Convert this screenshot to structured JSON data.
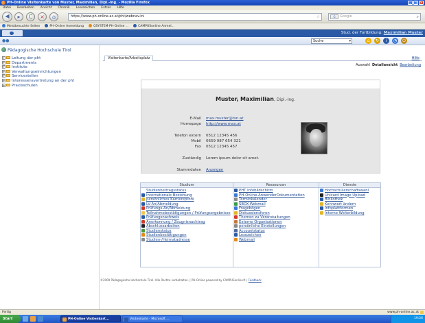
{
  "window": {
    "title": "PH-Online Visitenkarte von Muster, Maximilian, Dipl.-Ing. - Mozilla Firefox"
  },
  "menu": [
    "Datei",
    "Bearbeiten",
    "Ansicht",
    "Chronik",
    "Lesezeichen",
    "Extras",
    "Hilfe"
  ],
  "nav": {
    "url": "https://www.ph-online.ac.at/pht/webnav.ini",
    "search_placeholder": "Google"
  },
  "bookmarks": [
    {
      "label": "Meistbesuchte Seiten",
      "color": "#3a78d4"
    },
    {
      "label": "PH-Online Anmeldung",
      "color": "#2a5aa6"
    },
    {
      "label": "QSYSTEM-PH-Online ...",
      "color": "#e08a1a"
    },
    {
      "label": "CAMPUSonline Anmel...",
      "color": "#2a5aa6"
    }
  ],
  "portal": {
    "user_prefix": "Stud. der Fortbildung:",
    "user_name": "Maximilian Muster",
    "search_select": "Suche"
  },
  "sidebar": {
    "title": "Pädagogische Hochschule Tirol",
    "items": [
      "Leitung der pht",
      "Departments",
      "Institute",
      "Verwaltungseinrichtungen",
      "Servicestellen",
      "Interessensvertretung an der pht",
      "Praxisschulen"
    ]
  },
  "main": {
    "tab": "Visitenkarte/Arbeitsplatz",
    "help": "Hilfe",
    "view_links": {
      "auswahl": "Auswahl",
      "detailansicht": "Detailansicht",
      "bearbeiten": "Bearbeitung"
    },
    "person": {
      "last_name": "Muster,",
      "first_name": "Maximilian",
      "title": ", Dipl.-Ing."
    },
    "contact": {
      "email_label": "E-Mail",
      "email": "max.muster@tsn.at",
      "homepage_label": "Homepage",
      "homepage": "http://www.max.at",
      "phone_label": "Telefon extern",
      "phone": "0512 12345 456",
      "mobile_label": "Mobil",
      "mobile": "0659 987 654 321",
      "fax_label": "Fax",
      "fax": "0512 12345 457",
      "zust_label": "Zuständig",
      "zust": "Lorem ipsum dolor sit amet.",
      "stamm_label": "Stammdaten",
      "stamm": "Anzeigen"
    }
  },
  "services": {
    "studium": {
      "head": "Studium",
      "items": [
        {
          "label": "Studienbeitragsstatus",
          "color": "#ffffff"
        },
        {
          "label": "Internationale Beziehung",
          "color": "#2a5aa6"
        },
        {
          "label": "persönliches Karriereprofil",
          "color": "#e0b62a"
        },
        {
          "label": "LV-An/Abmeldung",
          "color": "#2a5aa6"
        },
        {
          "label": "Prüfungs-An/Abmeldung",
          "color": "#d03a2a"
        },
        {
          "label": "Teilnahmebestätigungen / Prüfungsergebnisse",
          "color": "#f0c64f"
        },
        {
          "label": "Prüfungsnachweis",
          "color": "#2a5aa6"
        },
        {
          "label": "Anerkennung / Zeugnisnachtrag",
          "color": "#d03a2a"
        },
        {
          "label": "Abschlussarbeiten",
          "color": "#222222"
        },
        {
          "label": "Studienstatus",
          "color": "#4a9a3a"
        },
        {
          "label": "Studienbestätigungen",
          "color": "#e08a1a"
        },
        {
          "label": "Studien-/Heimatadresse",
          "color": "#8a8a8a"
        }
      ]
    },
    "ressourcen": {
      "head": "Ressourcen",
      "items": [
        {
          "label": "PHT Infobildschirm",
          "color": "#2a5aa6"
        },
        {
          "label": "PH-Online-AnwenderDokumentation",
          "color": "#3a78d4"
        },
        {
          "label": "Terminkalender",
          "color": "#8a8a8a"
        },
        {
          "label": "SBOX-Webmail",
          "color": "#3a9a4a"
        },
        {
          "label": "Fragebögen",
          "color": "#3a78d4"
        },
        {
          "label": "Diskussionsforen",
          "color": "#e0b62a"
        },
        {
          "label": "Themen zu Veranstaltungen",
          "color": "#d03a2a"
        },
        {
          "label": "Externe Organisationen",
          "color": "#c07a3a"
        },
        {
          "label": "persönliche Einstellungen",
          "color": "#8a8a8a"
        },
        {
          "label": "Accountstatus",
          "color": "#4a6aa0"
        },
        {
          "label": "Lesezeichen",
          "color": "#2a5aa6"
        },
        {
          "label": "Webmail",
          "color": "#e08a1a"
        }
      ]
    },
    "dienste": {
      "head": "Dienste",
      "items": [
        {
          "label": "Hochschülerschaftswahl",
          "color": "#3a78d4"
        },
        {
          "label": "Unicard Image Upload",
          "color": "#222222"
        },
        {
          "label": "Bibliothek",
          "color": "#2a5aa6"
        },
        {
          "label": "Kennwort ändern",
          "color": "#e0b62a"
        },
        {
          "label": "Infoplattformen",
          "color": "#2a5aa6"
        },
        {
          "label": "Interne Weiterbildung",
          "color": "#e0b62a"
        }
      ]
    }
  },
  "footer": {
    "text": "©2009 Pädagogische Hochschule Tirol. Alle Rechte vorbehalten. | PH-Online powered by CAMPUSonline® |",
    "feedback": "Feedback"
  },
  "status": {
    "left": "Fertig",
    "url": "www.ph-online.ac.at"
  },
  "taskbar": {
    "start": "Start",
    "task1": "PH-Online Visitenkart...",
    "task2": "Visitenkarte - Microsoft ...",
    "clock": "19:26"
  }
}
